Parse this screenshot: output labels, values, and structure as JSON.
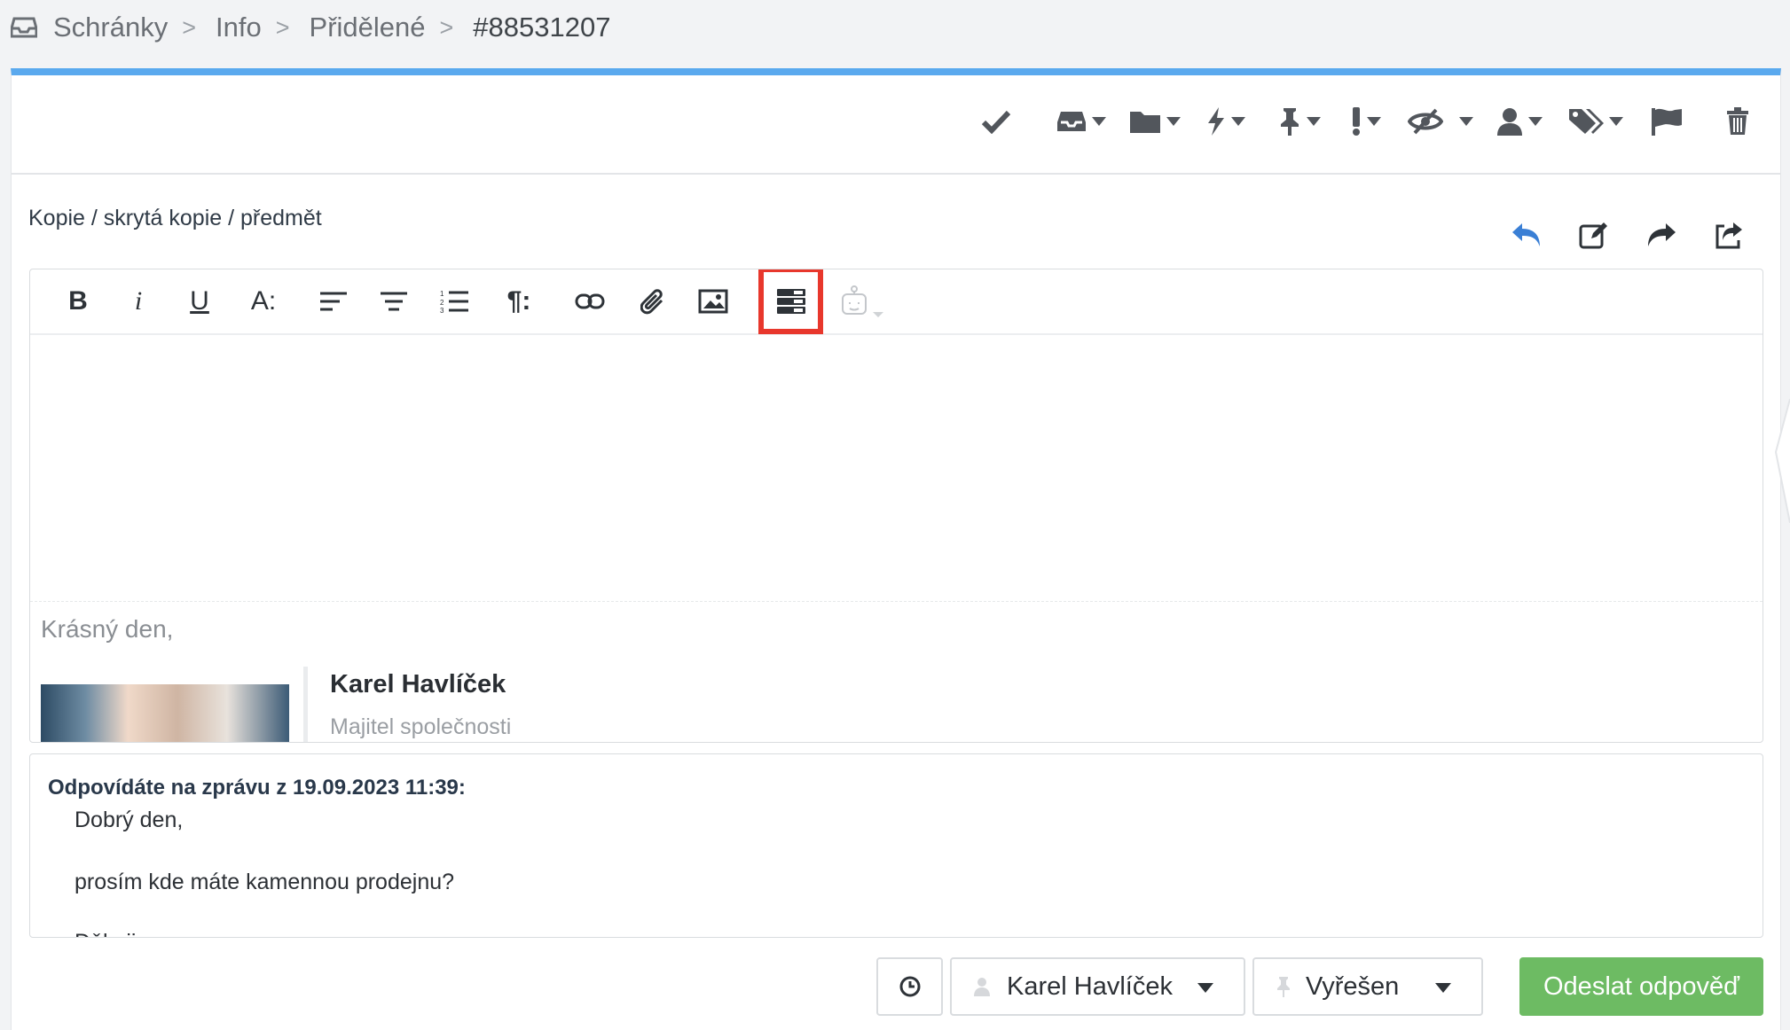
{
  "breadcrumb": {
    "items": [
      "Schránky",
      "Info",
      "Přidělené"
    ],
    "separator": ">",
    "current": "#88531207"
  },
  "toolbar": {
    "icons": [
      "check-icon",
      "inbox-icon",
      "folder-icon",
      "bolt-icon",
      "pin-icon",
      "exclamation-icon",
      "eye-slash-icon",
      "user-icon",
      "tags-icon",
      "flag-icon",
      "trash-icon"
    ]
  },
  "compose": {
    "copy_link": "Kopie / skrytá kopie / předmět",
    "actions": [
      "reply-icon",
      "edit-icon",
      "forward-icon",
      "share-icon"
    ]
  },
  "editor": {
    "format_buttons": {
      "bold": "B",
      "italic": "i",
      "underline": "U",
      "font_size": "A:",
      "paragraph": "¶:"
    }
  },
  "signature": {
    "greeting": "Krásný den,",
    "name": "Karel Havlíček",
    "role": "Majitel společnosti"
  },
  "quote": {
    "header": "Odpovídáte na zprávu z 19.09.2023 11:39:",
    "lines": [
      "Dobrý den,",
      "prosím kde máte kamennou prodejnu?",
      "Děkuji"
    ]
  },
  "footer": {
    "assignee": "Karel Havlíček",
    "status": "Vyřešen",
    "send_label": "Odeslat odpověď"
  },
  "colors": {
    "accent": "#5aa9ee",
    "send": "#6dbb63",
    "highlight": "#e8372c",
    "reply_blue": "#3a7fd5"
  }
}
